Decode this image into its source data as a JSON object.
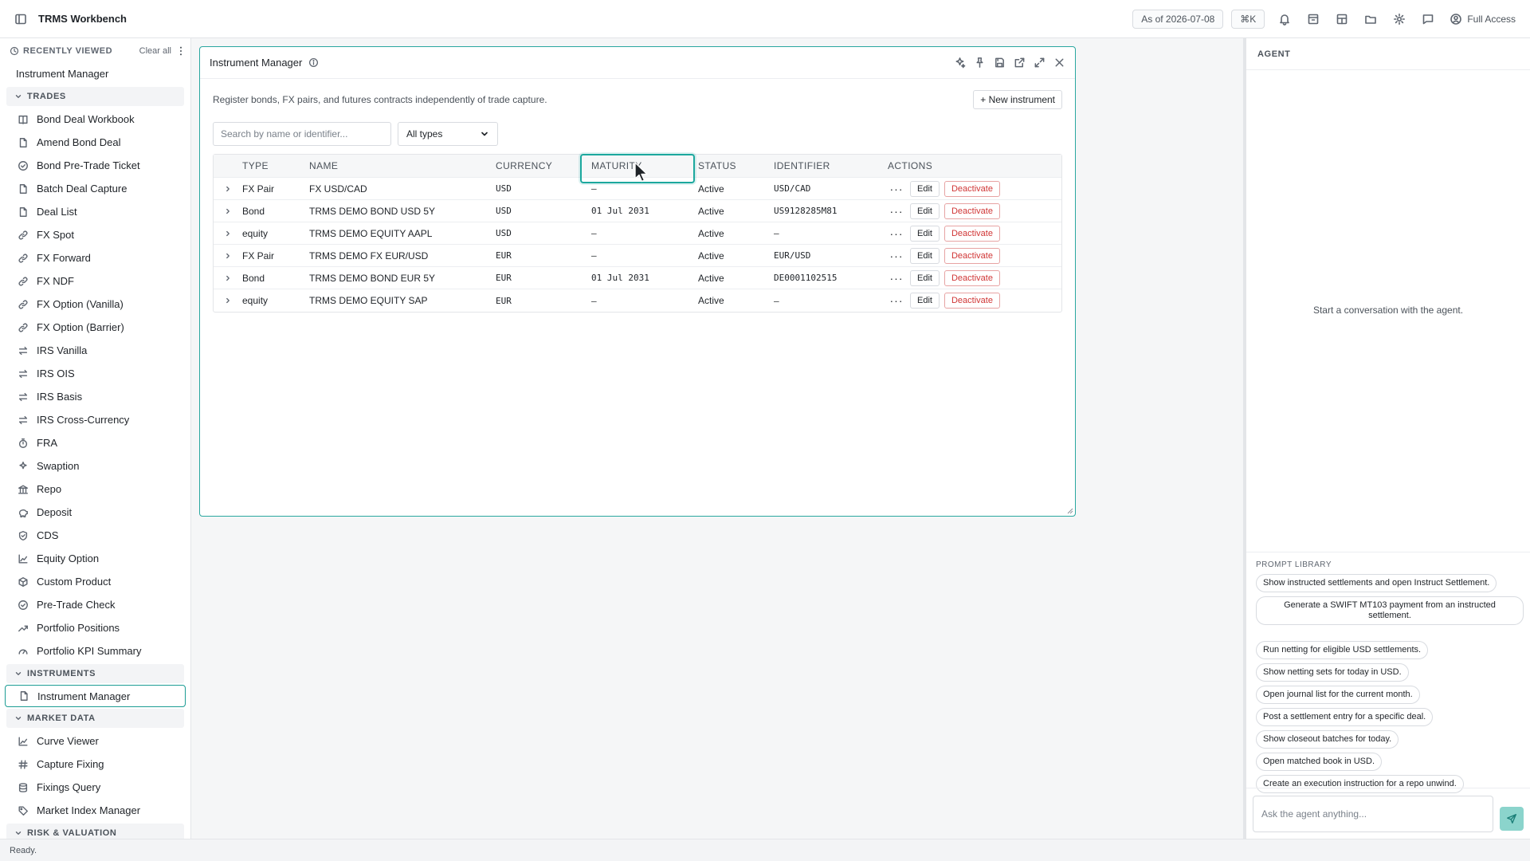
{
  "app": {
    "title": "TRMS Workbench"
  },
  "topbar": {
    "as_of": "As of 2026-07-08",
    "shortcut": "⌘K",
    "access": "Full Access",
    "icons": [
      "bell-icon",
      "archive-icon",
      "layout-icon",
      "folder-icon",
      "gear-icon",
      "chat-icon"
    ]
  },
  "sidebar": {
    "recent_title": "RECENTLY VIEWED",
    "clear_all": "Clear all",
    "recent_items": [
      "Instrument Manager"
    ],
    "sections": [
      {
        "title": "TRADES",
        "items": [
          {
            "label": "Bond Deal Workbook",
            "icon": "book-icon"
          },
          {
            "label": "Amend Bond Deal",
            "icon": "document-icon"
          },
          {
            "label": "Bond Pre-Trade Ticket",
            "icon": "check-circle-icon"
          },
          {
            "label": "Batch Deal Capture",
            "icon": "document-icon"
          },
          {
            "label": "Deal List",
            "icon": "document-icon"
          },
          {
            "label": "FX Spot",
            "icon": "link-icon"
          },
          {
            "label": "FX Forward",
            "icon": "link-icon"
          },
          {
            "label": "FX NDF",
            "icon": "link-icon"
          },
          {
            "label": "FX Option (Vanilla)",
            "icon": "link-icon"
          },
          {
            "label": "FX Option (Barrier)",
            "icon": "link-icon"
          },
          {
            "label": "IRS Vanilla",
            "icon": "swap-icon"
          },
          {
            "label": "IRS OIS",
            "icon": "swap-icon"
          },
          {
            "label": "IRS Basis",
            "icon": "swap-icon"
          },
          {
            "label": "IRS Cross-Currency",
            "icon": "swap-icon"
          },
          {
            "label": "FRA",
            "icon": "timer-icon"
          },
          {
            "label": "Swaption",
            "icon": "sparkle-icon"
          },
          {
            "label": "Repo",
            "icon": "bank-icon"
          },
          {
            "label": "Deposit",
            "icon": "piggy-bank-icon"
          },
          {
            "label": "CDS",
            "icon": "shield-icon"
          },
          {
            "label": "Equity Option",
            "icon": "line-chart-icon"
          },
          {
            "label": "Custom Product",
            "icon": "box-icon"
          },
          {
            "label": "Pre-Trade Check",
            "icon": "check-circle-icon"
          },
          {
            "label": "Portfolio Positions",
            "icon": "trend-icon"
          },
          {
            "label": "Portfolio KPI Summary",
            "icon": "gauge-icon"
          }
        ]
      },
      {
        "title": "INSTRUMENTS",
        "items": [
          {
            "label": "Instrument Manager",
            "icon": "document-icon",
            "active": true
          }
        ]
      },
      {
        "title": "MARKET DATA",
        "items": [
          {
            "label": "Curve Viewer",
            "icon": "line-chart-icon"
          },
          {
            "label": "Capture Fixing",
            "icon": "hash-icon"
          },
          {
            "label": "Fixings Query",
            "icon": "database-icon"
          },
          {
            "label": "Market Index Manager",
            "icon": "tag-icon"
          }
        ]
      },
      {
        "title": "RISK & VALUATION",
        "items": []
      }
    ]
  },
  "panel": {
    "title": "Instrument Manager",
    "description": "Register bonds, FX pairs, and futures contracts independently of trade capture.",
    "new_button": "+ New instrument",
    "search_placeholder": "Search by name or identifier...",
    "type_filter": "All types",
    "columns": [
      "TYPE",
      "NAME",
      "CURRENCY",
      "MATURITY",
      "STATUS",
      "IDENTIFIER",
      "ACTIONS"
    ],
    "rows": [
      {
        "type": "FX Pair",
        "name": "FX USD/CAD",
        "currency": "USD",
        "maturity": "—",
        "status": "Active",
        "identifier": "USD/CAD"
      },
      {
        "type": "Bond",
        "name": "TRMS DEMO BOND USD 5Y",
        "currency": "USD",
        "maturity": "01 Jul 2031",
        "status": "Active",
        "identifier": "US9128285M81"
      },
      {
        "type": "equity",
        "name": "TRMS DEMO EQUITY AAPL",
        "currency": "USD",
        "maturity": "—",
        "status": "Active",
        "identifier": "—"
      },
      {
        "type": "FX Pair",
        "name": "TRMS DEMO FX EUR/USD",
        "currency": "EUR",
        "maturity": "—",
        "status": "Active",
        "identifier": "EUR/USD"
      },
      {
        "type": "Bond",
        "name": "TRMS DEMO BOND EUR 5Y",
        "currency": "EUR",
        "maturity": "01 Jul 2031",
        "status": "Active",
        "identifier": "DE0001102515"
      },
      {
        "type": "equity",
        "name": "TRMS DEMO EQUITY SAP",
        "currency": "EUR",
        "maturity": "—",
        "status": "Active",
        "identifier": "—"
      }
    ],
    "more_label": "···",
    "edit_label": "Edit",
    "deactivate_label": "Deactivate"
  },
  "agent": {
    "title": "AGENT",
    "empty_text": "Start a conversation with the agent.",
    "prompt_library_title": "PROMPT LIBRARY",
    "prompts": [
      "Show instructed settlements and open Instruct Settlement.",
      "Generate a SWIFT MT103 payment from an instructed settlement.",
      "Run netting for eligible USD settlements.",
      "Show netting sets for today in USD.",
      "Open journal list for the current month.",
      "Post a settlement entry for a specific deal.",
      "Show closeout batches for today.",
      "Open matched book in USD.",
      "Create an execution instruction for a repo unwind."
    ],
    "input_placeholder": "Ask the agent anything..."
  },
  "status": {
    "text": "Ready."
  }
}
